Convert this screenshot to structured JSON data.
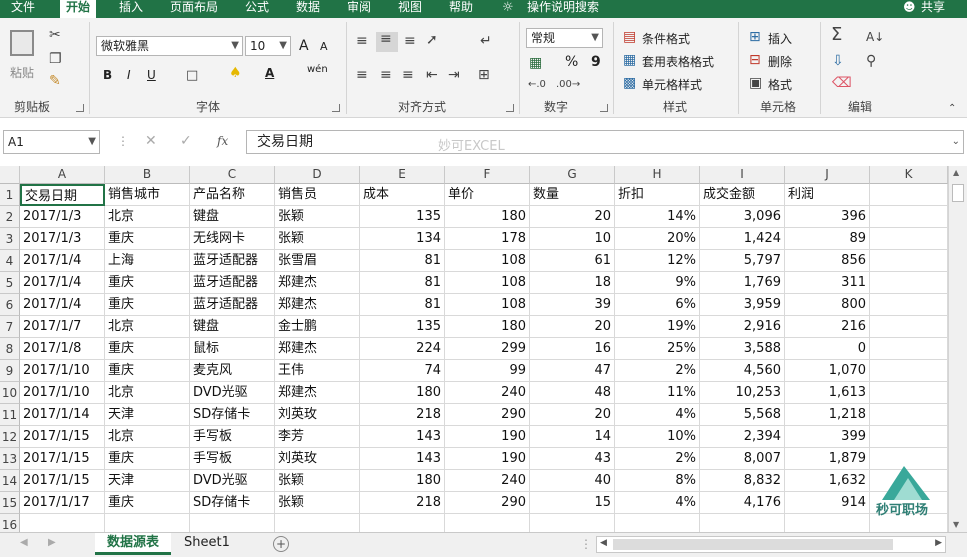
{
  "menu": {
    "items": [
      "文件",
      "开始",
      "插入",
      "页面布局",
      "公式",
      "数据",
      "审阅",
      "视图",
      "帮助"
    ],
    "tell_me": "操作说明搜索",
    "share": "共享"
  },
  "ribbon": {
    "clipboard": {
      "paste": "粘贴",
      "label": "剪贴板"
    },
    "font": {
      "name": "微软雅黑",
      "size": "10",
      "label": "字体",
      "grow": "A",
      "shrink": "A",
      "bold": "B",
      "italic": "I",
      "underline": "U",
      "pinyin": "wén",
      "color_letter": "A"
    },
    "align": {
      "label": "对齐方式"
    },
    "number": {
      "format": "常规",
      "label": "数字",
      "percent": "%",
      "comma": "9"
    },
    "styles": {
      "cond": "条件格式",
      "table": "套用表格格式",
      "cell": "单元格样式",
      "label": "样式"
    },
    "cells": {
      "insert": "插入",
      "delete": "删除",
      "format": "格式",
      "label": "单元格"
    },
    "editing": {
      "label": "编辑"
    }
  },
  "formula_bar": {
    "name_box": "A1",
    "fx": "fx",
    "content": "交易日期",
    "watermark": "妙可EXCEL"
  },
  "columns": [
    "A",
    "B",
    "C",
    "D",
    "E",
    "F",
    "G",
    "H",
    "I",
    "J",
    "K"
  ],
  "rows": [
    [
      "交易日期",
      "销售城市",
      "产品名称",
      "销售员",
      "成本",
      "单价",
      "数量",
      "折扣",
      "成交金额",
      "利润"
    ],
    [
      "2017/1/3",
      "北京",
      "键盘",
      "张颖",
      "135",
      "180",
      "20",
      "14%",
      "3,096",
      "396"
    ],
    [
      "2017/1/3",
      "重庆",
      "无线网卡",
      "张颖",
      "134",
      "178",
      "10",
      "20%",
      "1,424",
      "89"
    ],
    [
      "2017/1/4",
      "上海",
      "蓝牙适配器",
      "张雪眉",
      "81",
      "108",
      "61",
      "12%",
      "5,797",
      "856"
    ],
    [
      "2017/1/4",
      "重庆",
      "蓝牙适配器",
      "郑建杰",
      "81",
      "108",
      "18",
      "9%",
      "1,769",
      "311"
    ],
    [
      "2017/1/4",
      "重庆",
      "蓝牙适配器",
      "郑建杰",
      "81",
      "108",
      "39",
      "6%",
      "3,959",
      "800"
    ],
    [
      "2017/1/7",
      "北京",
      "键盘",
      "金士鹏",
      "135",
      "180",
      "20",
      "19%",
      "2,916",
      "216"
    ],
    [
      "2017/1/8",
      "重庆",
      "鼠标",
      "郑建杰",
      "224",
      "299",
      "16",
      "25%",
      "3,588",
      "0"
    ],
    [
      "2017/1/10",
      "重庆",
      "麦克风",
      "王伟",
      "74",
      "99",
      "47",
      "2%",
      "4,560",
      "1,070"
    ],
    [
      "2017/1/10",
      "北京",
      "DVD光驱",
      "郑建杰",
      "180",
      "240",
      "48",
      "11%",
      "10,253",
      "1,613"
    ],
    [
      "2017/1/14",
      "天津",
      "SD存储卡",
      "刘英玫",
      "218",
      "290",
      "20",
      "4%",
      "5,568",
      "1,218"
    ],
    [
      "2017/1/15",
      "北京",
      "手写板",
      "李芳",
      "143",
      "190",
      "14",
      "10%",
      "2,394",
      "399"
    ],
    [
      "2017/1/15",
      "重庆",
      "手写板",
      "刘英玫",
      "143",
      "190",
      "43",
      "2%",
      "8,007",
      "1,879"
    ],
    [
      "2017/1/15",
      "天津",
      "DVD光驱",
      "张颖",
      "180",
      "240",
      "40",
      "8%",
      "8,832",
      "1,632"
    ],
    [
      "2017/1/17",
      "重庆",
      "SD存储卡",
      "张颖",
      "218",
      "290",
      "15",
      "4%",
      "4,176",
      "914"
    ],
    [
      "",
      "",
      "",
      "",
      "",
      "",
      "",
      "",
      "",
      ""
    ]
  ],
  "sheets": [
    "数据源表",
    "Sheet1"
  ],
  "logo_text": "秒可职场",
  "colors": {
    "brand": "#217346",
    "grid": "#d9d9d9"
  }
}
